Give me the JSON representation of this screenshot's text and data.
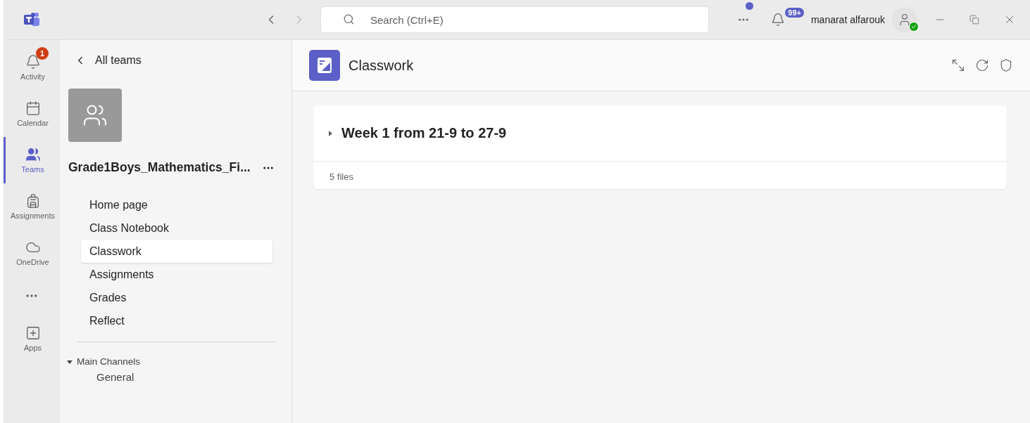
{
  "title_bar": {
    "search": {
      "placeholder": "Search (Ctrl+E)"
    },
    "notification_badge": "99+",
    "user_name": "manarat alfarouk"
  },
  "rail": [
    {
      "label": "Activity",
      "selected": false,
      "badge": "1"
    },
    {
      "label": "Calendar",
      "selected": false
    },
    {
      "label": "Teams",
      "selected": true
    },
    {
      "label": "Assignments",
      "selected": false
    },
    {
      "label": "OneDrive",
      "selected": false
    },
    {
      "label": "Apps",
      "selected": false
    }
  ],
  "team_panel": {
    "back_link": "All teams",
    "team_name": "Grade1Boys_Mathematics_Fi...",
    "nav": [
      {
        "label": "Home page",
        "selected": false
      },
      {
        "label": "Class Notebook",
        "selected": false
      },
      {
        "label": "Classwork",
        "selected": true
      },
      {
        "label": "Assignments",
        "selected": false
      },
      {
        "label": "Grades",
        "selected": false
      },
      {
        "label": "Reflect",
        "selected": false
      }
    ],
    "channels": {
      "label": "Main Channels",
      "expanded": true,
      "items": [
        "General"
      ]
    }
  },
  "main": {
    "title": "Classwork",
    "sections": [
      {
        "title": "Week 1 from 21-9 to 27-9",
        "expanded": false,
        "summary": "5 files"
      }
    ]
  }
}
